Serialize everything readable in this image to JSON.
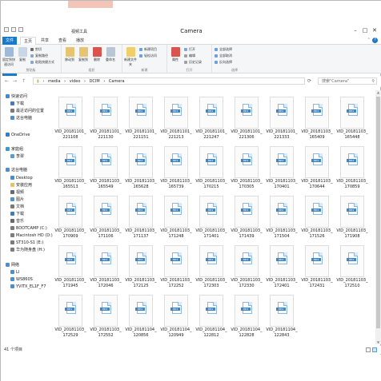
{
  "window": {
    "title": "Camera",
    "context_tab_label": "视频工具",
    "min_label": "–",
    "max_label": "□",
    "close_label": "✕"
  },
  "ribbon_tabs": [
    "文件",
    "主页",
    "共享",
    "查看",
    "播放"
  ],
  "ribbon": {
    "clipboard": {
      "label": "剪贴板",
      "pin": "固定到快速访问",
      "copy": "复制",
      "paste": "粘贴",
      "cut": "剪切",
      "copy_path": "复制路径",
      "paste_shortcut": "粘贴快捷方式"
    },
    "organize": {
      "label": "组织",
      "move_to": "移动到",
      "copy_to": "复制到",
      "delete": "删除",
      "rename": "重命名"
    },
    "new": {
      "label": "新建",
      "new_folder": "新建文件夹",
      "new_item": "新建项目",
      "easy_access": "轻松访问"
    },
    "open": {
      "label": "打开",
      "properties": "属性",
      "open": "打开",
      "edit": "编辑",
      "history": "历史记录"
    },
    "select": {
      "label": "选择",
      "select_all": "全部选择",
      "select_none": "全部取消",
      "invert": "反向选择"
    }
  },
  "address": {
    "back": "←",
    "forward": "→",
    "up": "↑",
    "path": [
      "media",
      "video",
      "DCIM",
      "Camera"
    ],
    "search_placeholder": "搜索\"Camera\"",
    "refresh": "⟳"
  },
  "nav_pane": [
    {
      "label": "快速访问",
      "icon": "star-icon",
      "color": "#3c8ad6"
    },
    {
      "label": "下载",
      "icon": "download-icon",
      "color": "#3d7cc9"
    },
    {
      "label": "最近访问的位置",
      "icon": "clock-icon",
      "color": "#7a7a7a"
    },
    {
      "label": "这台电脑",
      "icon": "computer-icon",
      "color": "#4a8fd6"
    },
    {
      "label": "OneDrive",
      "icon": "cloud-icon",
      "color": "#2f7fd0"
    },
    {
      "label": "家庭组",
      "icon": "homegroup-icon",
      "color": "#2f9fd0"
    },
    {
      "label": "李翠",
      "icon": "user-icon",
      "color": "#4f9fe0"
    },
    {
      "label": "这台电脑",
      "icon": "computer-icon",
      "color": "#4a8fd6"
    },
    {
      "label": "Desktop",
      "icon": "desktop-icon",
      "color": "#3d8fd8"
    },
    {
      "label": "安装应用",
      "icon": "folder-icon",
      "color": "#e8c15a"
    },
    {
      "label": "视频",
      "icon": "video-icon",
      "color": "#6a6a6a"
    },
    {
      "label": "图片",
      "icon": "picture-icon",
      "color": "#4f92d2"
    },
    {
      "label": "文档",
      "icon": "document-icon",
      "color": "#7a7a7a"
    },
    {
      "label": "下载",
      "icon": "download-icon",
      "color": "#3d7cc9"
    },
    {
      "label": "音乐",
      "icon": "music-icon",
      "color": "#6a6a6a"
    },
    {
      "label": "BOOTCAMP (C:)",
      "icon": "drive-icon",
      "color": "#7c7c7c"
    },
    {
      "label": "Macintosh HD (D:)",
      "icon": "drive-icon",
      "color": "#7c7c7c"
    },
    {
      "label": "ST310-S1 (E:)",
      "icon": "drive-icon",
      "color": "#7c7c7c"
    },
    {
      "label": "华为随身盘 (H:)",
      "icon": "drive-icon",
      "color": "#7c7c7c"
    },
    {
      "label": "网络",
      "icon": "network-icon",
      "color": "#4a8fd6"
    },
    {
      "label": "LI",
      "icon": "computer-icon",
      "color": "#4a8fd6"
    },
    {
      "label": "WS860S",
      "icon": "computer-icon",
      "color": "#4a8fd6"
    },
    {
      "label": "YVITX_EL1F_F7",
      "icon": "computer-icon",
      "color": "#4a8fd6"
    }
  ],
  "files": [
    "VID_20181101_221108",
    "VID_20181101_221130",
    "VID_20181101_221151",
    "VID_20181101_221213",
    "VID_20181101_221247",
    "VID_20181101_221306",
    "VID_20181101_221333",
    "VID_20181103_165409",
    "VID_20181103_165448",
    "VID_20181103_165513",
    "VID_20181103_165549",
    "VID_20181103_165628",
    "VID_20181103_165739",
    "VID_20181103_170215",
    "VID_20181103_170305",
    "VID_20181103_170401",
    "VID_20181103_170644",
    "VID_20181103_170859",
    "VID_20181103_170909",
    "VID_20181103_171106",
    "VID_20181103_171137",
    "VID_20181103_171248",
    "VID_20181103_171401",
    "VID_20181103_171439",
    "VID_20181103_171504",
    "VID_20181103_171526",
    "VID_20181103_171908",
    "VID_20181103_171945",
    "VID_20181103_172046",
    "VID_20181103_172125",
    "VID_20181103_172252",
    "VID_20181103_172303",
    "VID_20181103_172330",
    "VID_20181103_172401",
    "VID_20181103_172431",
    "VID_20181103_172510",
    "VID_20181103_172529",
    "VID_20181103_172552",
    "VID_20181104_120856",
    "VID_20181104_120949",
    "VID_20181104_122812",
    "VID_20181104_122828",
    "VID_20181104_122843"
  ],
  "file_badge": "MP4",
  "status": {
    "count": "41 个项目"
  },
  "colors": {
    "accent": "#1979ca",
    "context_tab": "#f3c5b8",
    "selection": "#cce8ff"
  }
}
